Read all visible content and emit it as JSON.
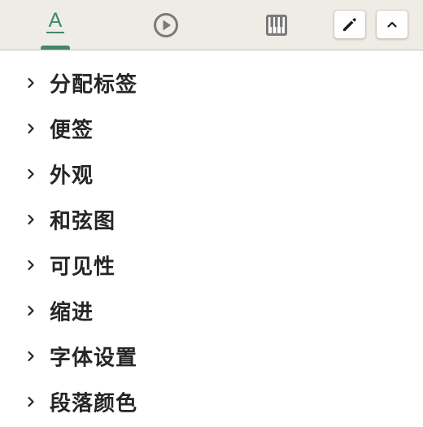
{
  "toolbar": {
    "tabs": [
      {
        "name": "text",
        "glyph": "A",
        "icon": "text-format-icon",
        "active": true
      },
      {
        "name": "playback",
        "icon": "play-circle-icon",
        "active": false
      },
      {
        "name": "piano",
        "icon": "piano-keys-icon",
        "active": false
      }
    ],
    "edit_button_icon": "pencil-icon",
    "collapse_button_icon": "chevron-up-icon"
  },
  "sections": [
    {
      "label": "分配标签"
    },
    {
      "label": "便签"
    },
    {
      "label": "外观"
    },
    {
      "label": "和弦图"
    },
    {
      "label": "可见性"
    },
    {
      "label": "缩进"
    },
    {
      "label": "字体设置"
    },
    {
      "label": "段落颜色"
    }
  ],
  "colors": {
    "accent": "#3f8a69",
    "toolbar_bg": "#efece6",
    "icon_gray": "#7a7a7a",
    "text": "#262626"
  }
}
